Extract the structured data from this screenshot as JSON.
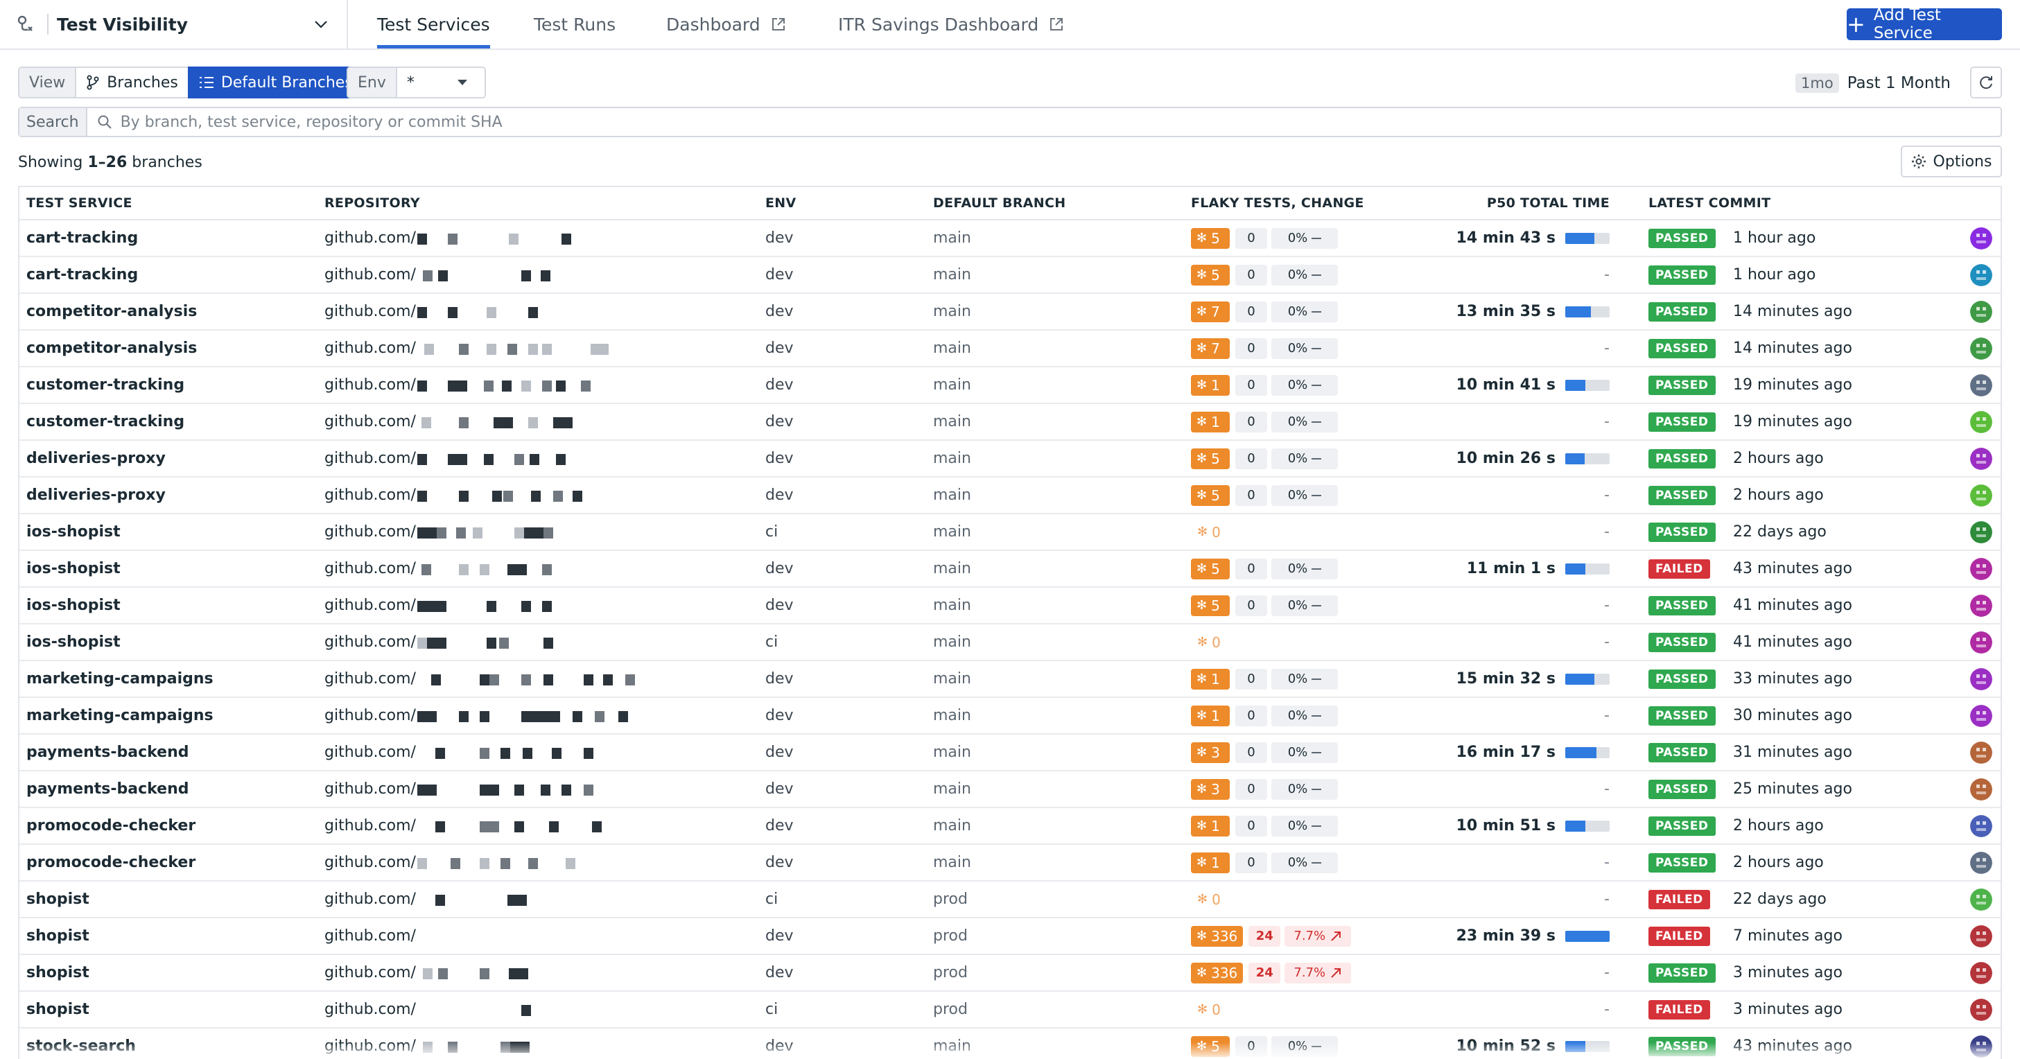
{
  "app": {
    "title": "Test Visibility",
    "tabs": [
      {
        "label": "Test Services",
        "active": true
      },
      {
        "label": "Test Runs"
      },
      {
        "label": "Dashboard",
        "external": true
      },
      {
        "label": "ITR Savings Dashboard",
        "external": true
      }
    ],
    "add_button": "Add Test Service"
  },
  "toolbar": {
    "view_label": "View",
    "branches_label": "Branches",
    "default_branches_label": "Default Branches",
    "env_label": "Env",
    "env_value": "*",
    "time_badge": "1mo",
    "time_label": "Past 1 Month"
  },
  "search": {
    "label": "Search",
    "placeholder": "By branch, test service, repository or commit SHA"
  },
  "summary": {
    "prefix": "Showing ",
    "range": "1–26",
    "suffix": " branches",
    "options_label": "Options"
  },
  "columns": {
    "service": "TEST SERVICE",
    "repository": "REPOSITORY",
    "env": "ENV",
    "branch": "DEFAULT BRANCH",
    "flaky": "FLAKY TESTS, CHANGE",
    "p50": "P50 TOTAL TIME",
    "commit": "LATEST COMMIT"
  },
  "colors": {
    "accent": "#1f55c4",
    "flaky": "#ed8a2a",
    "passed": "#2fa84f",
    "failed": "#d6323a",
    "bar": "#2f7be0"
  },
  "rows": [
    {
      "service": "cart-tracking",
      "repo": "github.com/",
      "env": "dev",
      "branch": "main",
      "flaky": "5",
      "chg": "0",
      "pct": "0%",
      "p50": "14 min 43 s",
      "bar": 0.65,
      "status": "PASSED",
      "ago": "1 hour ago",
      "avatar": "#8a2be2"
    },
    {
      "service": "cart-tracking",
      "repo": "github.com/",
      "env": "dev",
      "branch": "main",
      "flaky": "5",
      "chg": "0",
      "pct": "0%",
      "p50": "-",
      "bar": 0,
      "status": "PASSED",
      "ago": "1 hour ago",
      "avatar": "#1f8fbf"
    },
    {
      "service": "competitor-analysis",
      "repo": "github.com/",
      "env": "dev",
      "branch": "main",
      "flaky": "7",
      "chg": "0",
      "pct": "0%",
      "p50": "13 min 35 s",
      "bar": 0.58,
      "status": "PASSED",
      "ago": "14 minutes ago",
      "avatar": "#3f9a45"
    },
    {
      "service": "competitor-analysis",
      "repo": "github.com/",
      "env": "dev",
      "branch": "main",
      "flaky": "7",
      "chg": "0",
      "pct": "0%",
      "p50": "-",
      "bar": 0,
      "status": "PASSED",
      "ago": "14 minutes ago",
      "avatar": "#3f9a45"
    },
    {
      "service": "customer-tracking",
      "repo": "github.com/",
      "env": "dev",
      "branch": "main",
      "flaky": "1",
      "chg": "0",
      "pct": "0%",
      "p50": "10 min 41 s",
      "bar": 0.45,
      "status": "PASSED",
      "ago": "19 minutes ago",
      "avatar": "#5f6f86"
    },
    {
      "service": "customer-tracking",
      "repo": "github.com/",
      "env": "dev",
      "branch": "main",
      "flaky": "1",
      "chg": "0",
      "pct": "0%",
      "p50": "-",
      "bar": 0,
      "status": "PASSED",
      "ago": "19 minutes ago",
      "avatar": "#5bbd3a"
    },
    {
      "service": "deliveries-proxy",
      "repo": "github.com/",
      "env": "dev",
      "branch": "main",
      "flaky": "5",
      "chg": "0",
      "pct": "0%",
      "p50": "10 min 26 s",
      "bar": 0.44,
      "status": "PASSED",
      "ago": "2 hours ago",
      "avatar": "#9b2fc4"
    },
    {
      "service": "deliveries-proxy",
      "repo": "github.com/",
      "env": "dev",
      "branch": "main",
      "flaky": "5",
      "chg": "0",
      "pct": "0%",
      "p50": "-",
      "bar": 0,
      "status": "PASSED",
      "ago": "2 hours ago",
      "avatar": "#5bbd3a"
    },
    {
      "service": "ios-shopist",
      "repo": "github.com/",
      "env": "ci",
      "branch": "main",
      "flaky": "0",
      "chg": "",
      "pct": "",
      "p50": "-",
      "bar": 0,
      "status": "PASSED",
      "ago": "22 days ago",
      "avatar": "#2e8b3a"
    },
    {
      "service": "ios-shopist",
      "repo": "github.com/",
      "env": "dev",
      "branch": "main",
      "flaky": "5",
      "chg": "0",
      "pct": "0%",
      "p50": "11 min 1 s",
      "bar": 0.46,
      "status": "FAILED",
      "ago": "43 minutes ago",
      "avatar": "#b02aa3"
    },
    {
      "service": "ios-shopist",
      "repo": "github.com/",
      "env": "dev",
      "branch": "main",
      "flaky": "5",
      "chg": "0",
      "pct": "0%",
      "p50": "-",
      "bar": 0,
      "status": "PASSED",
      "ago": "41 minutes ago",
      "avatar": "#b02aa3"
    },
    {
      "service": "ios-shopist",
      "repo": "github.com/",
      "env": "ci",
      "branch": "main",
      "flaky": "0",
      "chg": "",
      "pct": "",
      "p50": "-",
      "bar": 0,
      "status": "PASSED",
      "ago": "41 minutes ago",
      "avatar": "#b02aa3"
    },
    {
      "service": "marketing-campaigns",
      "repo": "github.com/",
      "env": "dev",
      "branch": "main",
      "flaky": "1",
      "chg": "0",
      "pct": "0%",
      "p50": "15 min 32 s",
      "bar": 0.66,
      "status": "PASSED",
      "ago": "33 minutes ago",
      "avatar": "#9b2fc4"
    },
    {
      "service": "marketing-campaigns",
      "repo": "github.com/",
      "env": "dev",
      "branch": "main",
      "flaky": "1",
      "chg": "0",
      "pct": "0%",
      "p50": "-",
      "bar": 0,
      "status": "PASSED",
      "ago": "30 minutes ago",
      "avatar": "#9b2fc4"
    },
    {
      "service": "payments-backend",
      "repo": "github.com/",
      "env": "dev",
      "branch": "main",
      "flaky": "3",
      "chg": "0",
      "pct": "0%",
      "p50": "16 min 17 s",
      "bar": 0.7,
      "status": "PASSED",
      "ago": "31 minutes ago",
      "avatar": "#b5653a"
    },
    {
      "service": "payments-backend",
      "repo": "github.com/",
      "env": "dev",
      "branch": "main",
      "flaky": "3",
      "chg": "0",
      "pct": "0%",
      "p50": "-",
      "bar": 0,
      "status": "PASSED",
      "ago": "25 minutes ago",
      "avatar": "#b5653a"
    },
    {
      "service": "promocode-checker",
      "repo": "github.com/",
      "env": "dev",
      "branch": "main",
      "flaky": "1",
      "chg": "0",
      "pct": "0%",
      "p50": "10 min 51 s",
      "bar": 0.46,
      "status": "PASSED",
      "ago": "2 hours ago",
      "avatar": "#4a5fb8"
    },
    {
      "service": "promocode-checker",
      "repo": "github.com/",
      "env": "dev",
      "branch": "main",
      "flaky": "1",
      "chg": "0",
      "pct": "0%",
      "p50": "-",
      "bar": 0,
      "status": "PASSED",
      "ago": "2 hours ago",
      "avatar": "#5f6f86"
    },
    {
      "service": "shopist",
      "repo": "github.com/",
      "env": "ci",
      "branch": "prod",
      "flaky": "0",
      "chg": "",
      "pct": "",
      "p50": "-",
      "bar": 0,
      "status": "FAILED",
      "ago": "22 days ago",
      "avatar": "#4db34a"
    },
    {
      "service": "shopist",
      "repo": "github.com/",
      "env": "dev",
      "branch": "prod",
      "flaky": "336",
      "chg": "24",
      "pct": "7.7%",
      "up": true,
      "p50": "23 min 39 s",
      "bar": 1.0,
      "status": "FAILED",
      "ago": "7 minutes ago",
      "avatar": "#b3343a"
    },
    {
      "service": "shopist",
      "repo": "github.com/",
      "env": "dev",
      "branch": "prod",
      "flaky": "336",
      "chg": "24",
      "pct": "7.7%",
      "up": true,
      "p50": "-",
      "bar": 0,
      "status": "PASSED",
      "ago": "3 minutes ago",
      "avatar": "#b3343a"
    },
    {
      "service": "shopist",
      "repo": "github.com/",
      "env": "ci",
      "branch": "prod",
      "flaky": "0",
      "chg": "",
      "pct": "",
      "p50": "-",
      "bar": 0,
      "status": "FAILED",
      "ago": "3 minutes ago",
      "avatar": "#b3343a"
    },
    {
      "service": "stock-search",
      "repo": "github.com/",
      "env": "dev",
      "branch": "main",
      "flaky": "5",
      "chg": "0",
      "pct": "0%",
      "p50": "10 min 52 s",
      "bar": 0.46,
      "status": "PASSED",
      "ago": "43 minutes ago",
      "avatar": "#3a3f8a"
    }
  ]
}
